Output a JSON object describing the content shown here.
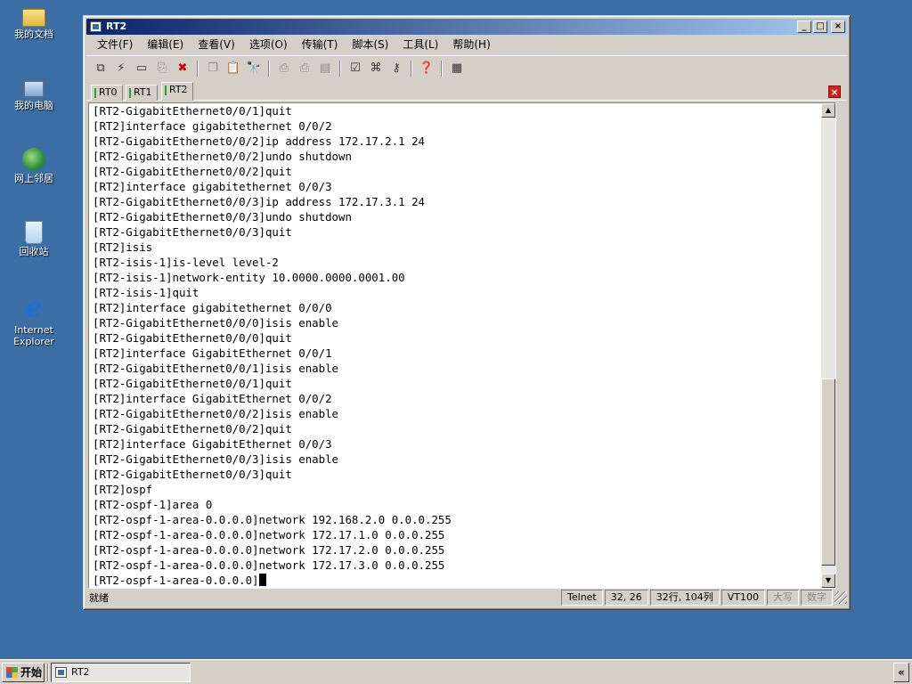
{
  "desktop": {
    "icons": [
      {
        "label": "我的文档"
      },
      {
        "label": "我的电脑"
      },
      {
        "label": "网上邻居"
      },
      {
        "label": "回收站"
      },
      {
        "label": "Internet Explorer"
      }
    ]
  },
  "window": {
    "title": "RT2",
    "controls": {
      "minimize": "_",
      "maximize": "□",
      "close": "×"
    }
  },
  "menu": [
    "文件(F)",
    "编辑(E)",
    "查看(V)",
    "选项(O)",
    "传输(T)",
    "脚本(S)",
    "工具(L)",
    "帮助(H)"
  ],
  "toolbar": {
    "icons": [
      "connect-icon",
      "quick-connect-icon",
      "reconnect-icon",
      "clone-icon",
      "disconnect-icon",
      "copy-icon",
      "paste-icon",
      "find-icon",
      "print-setup-icon",
      "print-icon",
      "print-screen-icon",
      "session-options-icon",
      "keymap-icon",
      "key-icon",
      "help-icon",
      "options-icon"
    ]
  },
  "tabs": [
    {
      "label": "RT0",
      "active": false
    },
    {
      "label": "RT1",
      "active": false
    },
    {
      "label": "RT2",
      "active": true
    }
  ],
  "terminal": {
    "lines": [
      "[RT2-GigabitEthernet0/0/1]quit",
      "[RT2]interface gigabitethernet 0/0/2",
      "[RT2-GigabitEthernet0/0/2]ip address 172.17.2.1 24",
      "[RT2-GigabitEthernet0/0/2]undo shutdown",
      "[RT2-GigabitEthernet0/0/2]quit",
      "[RT2]interface gigabitethernet 0/0/3",
      "[RT2-GigabitEthernet0/0/3]ip address 172.17.3.1 24",
      "[RT2-GigabitEthernet0/0/3]undo shutdown",
      "[RT2-GigabitEthernet0/0/3]quit",
      "[RT2]isis",
      "[RT2-isis-1]is-level level-2",
      "[RT2-isis-1]network-entity 10.0000.0000.0001.00",
      "[RT2-isis-1]quit",
      "[RT2]interface gigabitethernet 0/0/0",
      "[RT2-GigabitEthernet0/0/0]isis enable",
      "[RT2-GigabitEthernet0/0/0]quit",
      "[RT2]interface GigabitEthernet 0/0/1",
      "[RT2-GigabitEthernet0/0/1]isis enable",
      "[RT2-GigabitEthernet0/0/1]quit",
      "[RT2]interface GigabitEthernet 0/0/2",
      "[RT2-GigabitEthernet0/0/2]isis enable",
      "[RT2-GigabitEthernet0/0/2]quit",
      "[RT2]interface GigabitEthernet 0/0/3",
      "[RT2-GigabitEthernet0/0/3]isis enable",
      "[RT2-GigabitEthernet0/0/3]quit",
      "[RT2]ospf",
      "[RT2-ospf-1]area 0",
      "[RT2-ospf-1-area-0.0.0.0]network 192.168.2.0 0.0.0.255",
      "[RT2-ospf-1-area-0.0.0.0]network 172.17.1.0 0.0.0.255",
      "[RT2-ospf-1-area-0.0.0.0]network 172.17.2.0 0.0.0.255",
      "[RT2-ospf-1-area-0.0.0.0]network 172.17.3.0 0.0.0.255"
    ],
    "prompt": "[RT2-ospf-1-area-0.0.0.0]",
    "scroll_position": 0.97
  },
  "status": {
    "ready": "就绪",
    "protocol": "Telnet",
    "cursor_pos": "32,  26",
    "size": "32行, 104列",
    "emulation": "VT100",
    "caps": "大写",
    "num": "数字"
  },
  "taskbar": {
    "start_label": "开始",
    "task_label": "RT2",
    "tray_label": "«"
  }
}
